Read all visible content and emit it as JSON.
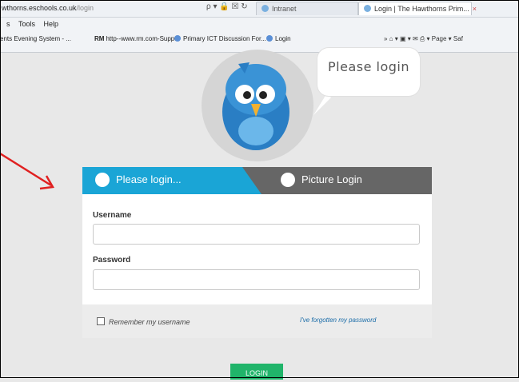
{
  "browser": {
    "address_domain": "wthorns.eschools.co.uk",
    "address_path": "/login",
    "address_icons": "ρ ▾ 🔒 ☒ ↻",
    "tab_inactive_label": "Intranet",
    "tab_active_label": "Login | The Hawthorns Prim...",
    "tab_close": "×",
    "menu": [
      "s",
      "Tools",
      "Help"
    ],
    "favorites": [
      {
        "label": "ents Evening System - ..."
      },
      {
        "prefix": "RM",
        "label": "http--www.rm.com-Supp..."
      },
      {
        "label": "Primary ICT Discussion For..."
      },
      {
        "label": "Login"
      }
    ],
    "toolbar_right": "» ⌂ ▾ ▣ ▾ ✉ ⎙ ▾ Page ▾ Saf"
  },
  "mascot": {
    "speech": "Please login"
  },
  "login": {
    "tab_login": "Please login...",
    "tab_picture": "Picture Login",
    "username_label": "Username",
    "username_value": "",
    "password_label": "Password",
    "password_value": "",
    "remember_label": "Remember my username",
    "forgot_label": "I've forgotten my password",
    "button_label": "LOGIN"
  },
  "colors": {
    "tab_active": "#1aa5d6",
    "tab_inactive": "#666666",
    "login_button": "#20b46a",
    "annotation_arrow": "#e02020"
  }
}
